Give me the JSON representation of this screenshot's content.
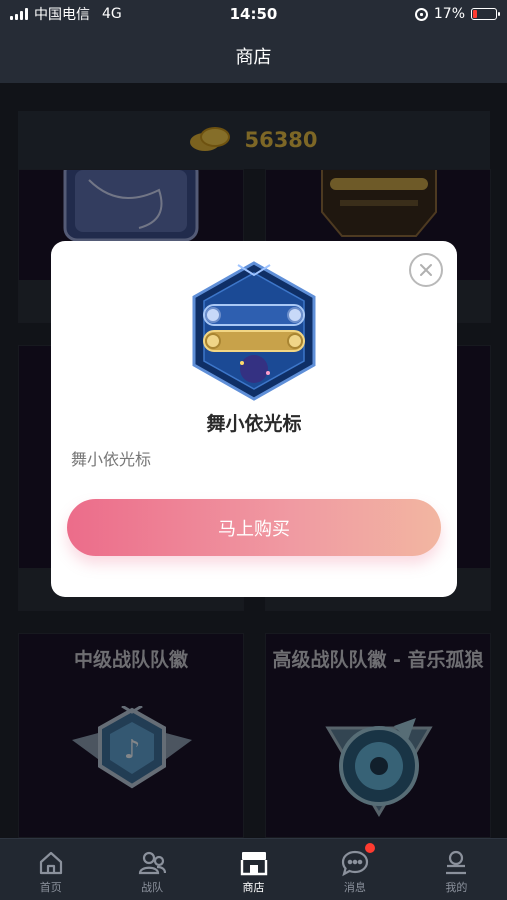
{
  "status_bar": {
    "carrier": "中国电信",
    "network": "4G",
    "time": "14:50",
    "battery_percent": "17%",
    "battery_level": 0.17
  },
  "nav": {
    "title": "商店"
  },
  "shop": {
    "coins": "56380",
    "items": [
      {
        "title": "中级战队队徽"
      },
      {
        "title": "高级战队队徽 - 音乐孤狼"
      }
    ]
  },
  "modal": {
    "title": "舞小依光标",
    "description": "舞小依光标",
    "buy_label": "马上购买"
  },
  "tabbar": {
    "tabs": [
      {
        "label": "首页",
        "icon": "home-icon"
      },
      {
        "label": "战队",
        "icon": "team-icon"
      },
      {
        "label": "商店",
        "icon": "store-icon",
        "active": true
      },
      {
        "label": "消息",
        "icon": "message-icon",
        "badge": true
      },
      {
        "label": "我的",
        "icon": "profile-icon"
      }
    ]
  },
  "colors": {
    "accent_gradient_start": "#ec6c8a",
    "accent_gradient_end": "#f2b6a1",
    "coin_gold": "#e4bc46",
    "notification_red": "#ff3b30"
  }
}
